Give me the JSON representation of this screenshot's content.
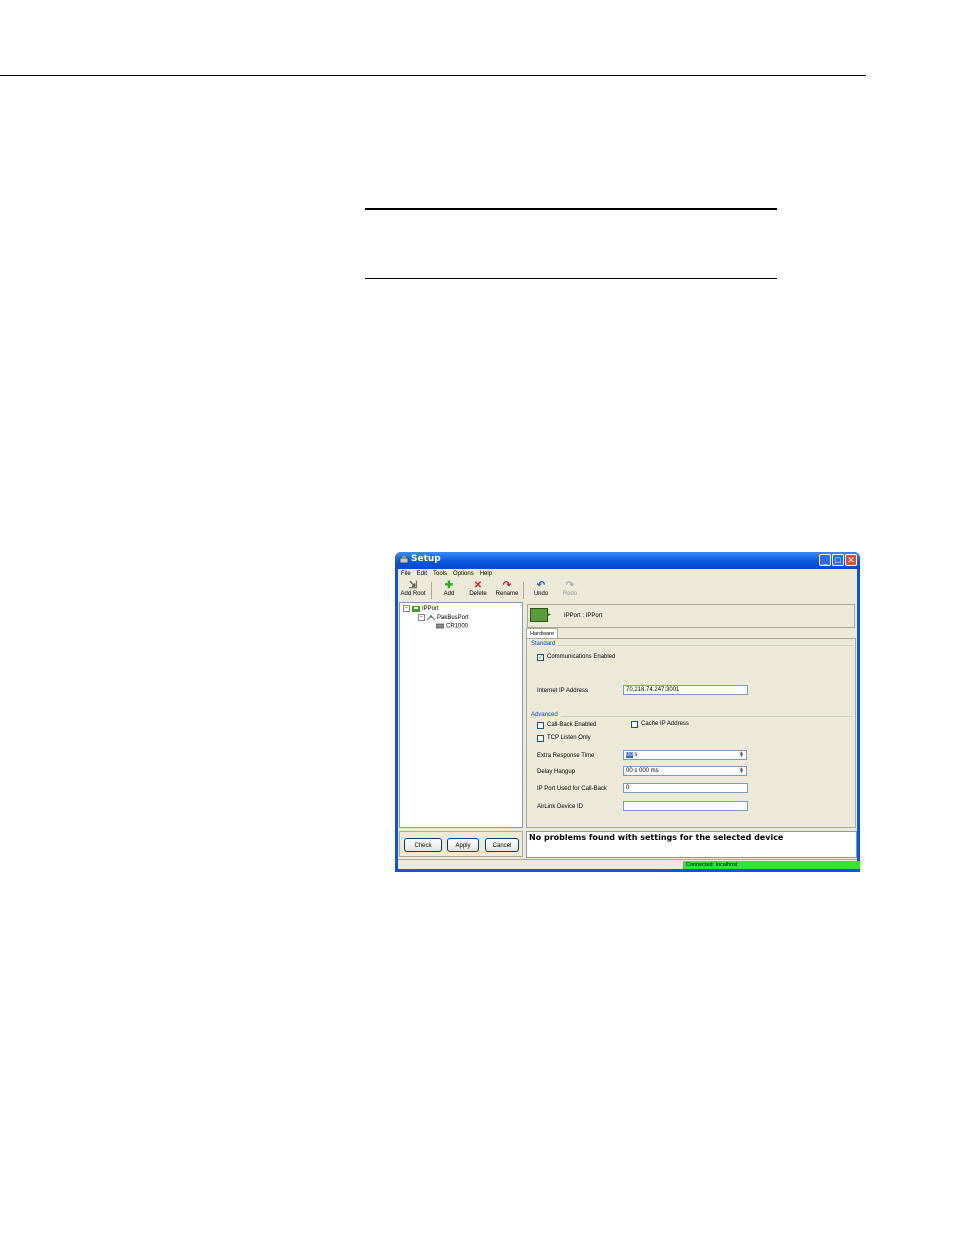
{
  "window": {
    "title": "Setup",
    "controls": [
      "_",
      "□",
      "✕"
    ]
  },
  "menu": [
    "File",
    "Edit",
    "Tools",
    "Options",
    "Help"
  ],
  "toolbar": [
    {
      "label": "Add Root",
      "icon": "add-root-icon",
      "glyph": "⇲",
      "enabled": true
    },
    {
      "label": "Add",
      "icon": "add-icon",
      "glyph": "✚",
      "enabled": true
    },
    {
      "label": "Delete",
      "icon": "delete-icon",
      "glyph": "✕",
      "enabled": true
    },
    {
      "label": "Rename",
      "icon": "rename-icon",
      "glyph": "↷",
      "enabled": true
    },
    {
      "label": "Undo",
      "icon": "undo-icon",
      "glyph": "↶",
      "enabled": true
    },
    {
      "label": "Redo",
      "icon": "redo-icon",
      "glyph": "↷",
      "enabled": false
    }
  ],
  "tree": {
    "root": {
      "label": "IPPort",
      "expand": "−"
    },
    "child": {
      "label": "PakBusPort",
      "expand": "−"
    },
    "leaf": {
      "label": "CR1000"
    }
  },
  "left_buttons": {
    "check": "Check",
    "apply": "Apply",
    "cancel": "Cancel"
  },
  "device_header": {
    "label": "IPPort : IPPort"
  },
  "tab": {
    "label": "Hardware"
  },
  "standard": {
    "title": "Standard",
    "comm_enabled": {
      "label": "Communications Enabled",
      "checked": true
    },
    "ip_label": "Internet IP Address",
    "ip_value": "70.218.74.247:3001"
  },
  "advanced": {
    "title": "Advanced",
    "callback": {
      "label": "Call-Back Enabled",
      "checked": false
    },
    "cache_ip": {
      "label": "Cache IP Address",
      "checked": false
    },
    "tcp_listen": {
      "label": "TCP Listen Only",
      "checked": false
    },
    "extra_resp_label": "Extra Response Time",
    "extra_resp_sel": "00",
    "extra_resp_rest": " s",
    "delay_hangup_label": "Delay Hangup",
    "delay_hangup_value": "00 s 000 ms",
    "ipport_cb_label": "IP Port Used for Call-Back",
    "ipport_cb_value": "0",
    "airlink_label": "AirLink Device ID",
    "airlink_value": ""
  },
  "message": "No problems found with settings for the selected device",
  "status": {
    "connection": "Connected: localhost",
    "connection_color": "#33e33a"
  }
}
